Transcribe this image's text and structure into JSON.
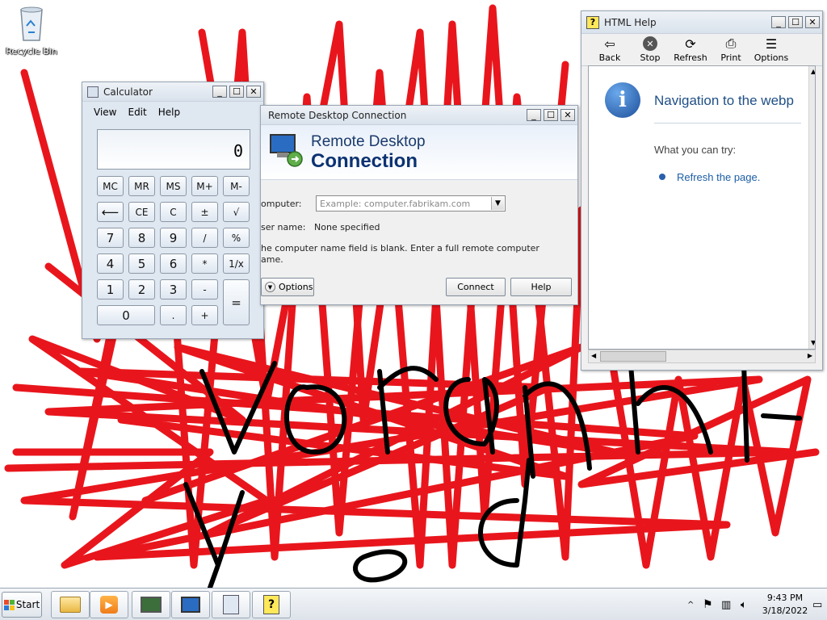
{
  "desktop": {
    "recycle_bin_label": "Recycle Bin"
  },
  "calculator": {
    "title": "Calculator",
    "menu": [
      "View",
      "Edit",
      "Help"
    ],
    "display": "0",
    "buttons": {
      "mc": "MC",
      "mr": "MR",
      "ms": "MS",
      "mplus": "M+",
      "mminus": "M-",
      "back": "⟵",
      "ce": "CE",
      "c": "C",
      "plusminus": "±",
      "sqrt": "√",
      "n7": "7",
      "n8": "8",
      "n9": "9",
      "div": "/",
      "pct": "%",
      "n4": "4",
      "n5": "5",
      "n6": "6",
      "mul": "*",
      "recip": "1/x",
      "n1": "1",
      "n2": "2",
      "n3": "3",
      "minus": "-",
      "equals": "=",
      "n0": "0",
      "dot": ".",
      "plus": "+"
    }
  },
  "rdc": {
    "title": "Remote Desktop Connection",
    "banner_line1": "Remote Desktop",
    "banner_line2": "Connection",
    "computer_label": "omputer:",
    "computer_placeholder": "Example: computer.fabrikam.com",
    "username_label": "ser name:",
    "username_value": "None specified",
    "message_line1": "he computer name field is blank. Enter a full remote computer",
    "message_line2": "ame.",
    "options_button": "Options",
    "connect_button": "Connect",
    "help_button": "Help"
  },
  "help": {
    "title": "HTML Help",
    "toolbar": {
      "back": "Back",
      "stop": "Stop",
      "refresh": "Refresh",
      "print": "Print",
      "options": "Options"
    },
    "heading": "Navigation to the webp",
    "try_label": "What you can try:",
    "suggestion": "Refresh the page."
  },
  "taskbar": {
    "start_label": "Start",
    "time": "9:43 PM",
    "date": "3/18/2022"
  },
  "colors": {
    "scribble_red": "#e8161c",
    "scribble_black": "#000000",
    "link_blue": "#1c5ea6",
    "banner_blue": "#0c3272"
  }
}
